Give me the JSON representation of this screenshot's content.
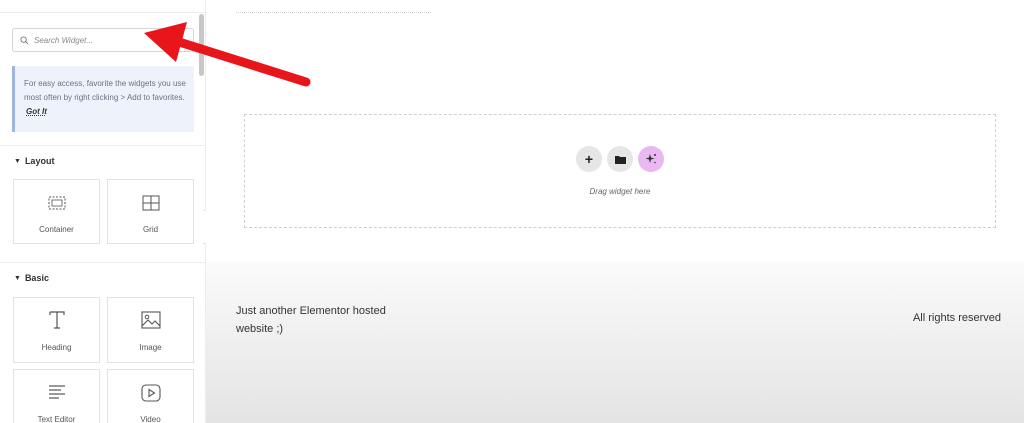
{
  "search": {
    "placeholder": "Search Widget..."
  },
  "tip": {
    "text": "For easy access, favorite the widgets you use most often by right clicking > Add to favorites.",
    "action": "Got It"
  },
  "sections": {
    "layout": {
      "title": "Layout",
      "widgets": [
        {
          "label": "Container",
          "icon": "container-icon"
        },
        {
          "label": "Grid",
          "icon": "grid-icon"
        }
      ]
    },
    "basic": {
      "title": "Basic",
      "widgets": [
        {
          "label": "Heading",
          "icon": "heading-icon"
        },
        {
          "label": "Image",
          "icon": "image-icon"
        },
        {
          "label": "Text Editor",
          "icon": "text-editor-icon"
        },
        {
          "label": "Video",
          "icon": "video-icon"
        }
      ]
    }
  },
  "canvas": {
    "dropzone_text": "Drag widget here",
    "buttons": [
      "add-icon",
      "folder-icon",
      "ai-sparkle-icon"
    ],
    "footer": {
      "left": "Just another Elementor hosted website ;)",
      "right": "All rights reserved"
    }
  },
  "colors": {
    "annotation_arrow": "#e8161b",
    "ai_button": "#eab7f2",
    "tip_background": "#eef3fb",
    "tip_border": "#9fb6e3"
  }
}
